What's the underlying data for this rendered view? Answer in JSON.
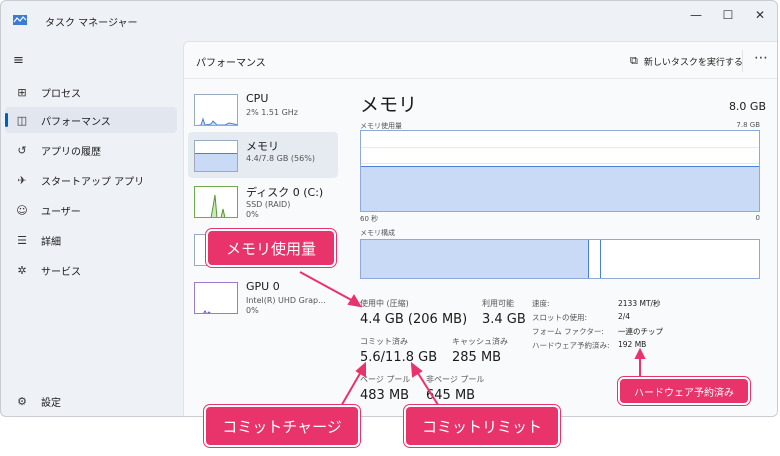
{
  "window": {
    "title": "タスク マネージャー",
    "controls": {
      "minimize": "—",
      "maximize": "☐",
      "close": "✕"
    }
  },
  "sidebar": {
    "items": [
      {
        "icon": "processes-icon",
        "glyph": "⊞",
        "label": "プロセス"
      },
      {
        "icon": "performance-icon",
        "glyph": "◫",
        "label": "パフォーマンス"
      },
      {
        "icon": "history-icon",
        "glyph": "↺",
        "label": "アプリの履歴"
      },
      {
        "icon": "startup-icon",
        "glyph": "✈",
        "label": "スタートアップ アプリ"
      },
      {
        "icon": "users-icon",
        "glyph": "☺",
        "label": "ユーザー"
      },
      {
        "icon": "details-icon",
        "glyph": "☰",
        "label": "詳細"
      },
      {
        "icon": "services-icon",
        "glyph": "✲",
        "label": "サービス"
      }
    ],
    "settings": {
      "icon": "gear-icon",
      "glyph": "⚙",
      "label": "設定"
    }
  },
  "header": {
    "title": "パフォーマンス",
    "run_task": "新しいタスクを実行する",
    "more": "⋯"
  },
  "resources": [
    {
      "name": "CPU",
      "sub1": "2%  1.51 GHz",
      "sub2": ""
    },
    {
      "name": "メモリ",
      "sub1": "4.4/7.8 GB (56%)",
      "sub2": ""
    },
    {
      "name": "ディスク 0 (C:)",
      "sub1": "SSD (RAID)",
      "sub2": "0%"
    },
    {
      "name": "",
      "sub1": "",
      "sub2": ""
    },
    {
      "name": "GPU 0",
      "sub1": "Intel(R) UHD Grap...",
      "sub2": "0%"
    }
  ],
  "memory": {
    "title": "メモリ",
    "total": "8.0 GB",
    "usage_label": "メモリ使用量",
    "usage_max": "7.8 GB",
    "time_left": "60 秒",
    "time_right": "0",
    "composition_label": "メモリ構成",
    "usage_fraction": 0.56,
    "stats": {
      "in_use_label": "使用中 (圧縮)",
      "in_use_value": "4.4 GB (206 MB)",
      "available_label": "利用可能",
      "available_value": "3.4 GB",
      "committed_label": "コミット済み",
      "committed_value": "5.6/11.8 GB",
      "cached_label": "キャッシュ済み",
      "cached_value": "285 MB",
      "paged_label": "ページ プール",
      "paged_value": "483 MB",
      "nonpaged_label": "非ページ プール",
      "nonpaged_value": "645 MB"
    },
    "specs": [
      {
        "key": "速度:",
        "value": "2133 MT/秒"
      },
      {
        "key": "スロットの使用:",
        "value": "2/4"
      },
      {
        "key": "フォーム ファクター:",
        "value": "一連のチップ"
      },
      {
        "key": "ハードウェア予約済み:",
        "value": "192 MB"
      }
    ]
  },
  "callouts": {
    "memory_usage": "メモリ使用量",
    "commit_charge": "コミットチャージ",
    "commit_limit": "コミットリミット",
    "hw_reserved": "ハードウェア予約済み"
  },
  "colors": {
    "accent": "#005fb8",
    "callout": "#e8336b",
    "graph_fill": "#c9daf6",
    "graph_line": "#4a80d6"
  }
}
